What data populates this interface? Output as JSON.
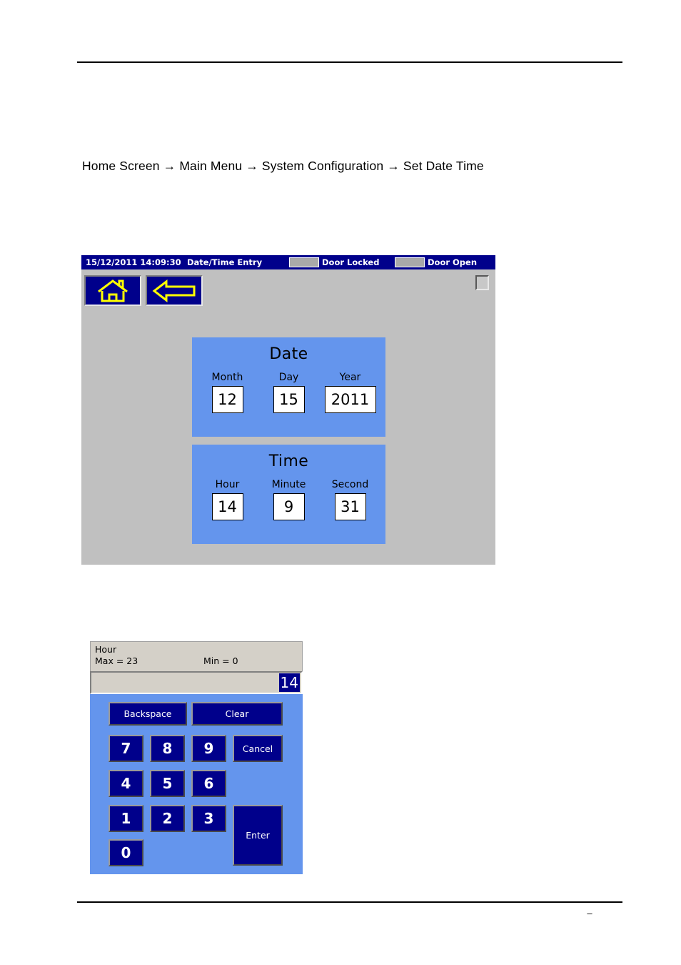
{
  "page": {
    "number": "–",
    "breadcrumb": "Home Screen → Main Menu → System Configuration → Set Date Time"
  },
  "hmi_screen": {
    "statusbar": {
      "datetime": "15/12/2011 14:09:30",
      "title": "Date/Time Entry",
      "indicators": [
        {
          "label": "Door Locked",
          "state_color": "#a9a9a9"
        },
        {
          "label": "Door Open",
          "state_color": "#a9a9a9"
        }
      ]
    },
    "nav": {
      "home_icon": "home-icon",
      "back_icon": "left-arrow-icon",
      "icon_color": "#FFFF00",
      "button_color": "#00008B"
    },
    "panels": [
      {
        "title": "Date",
        "fields": [
          {
            "label": "Month",
            "value": "12",
            "wide": false
          },
          {
            "label": "Day",
            "value": "15",
            "wide": false
          },
          {
            "label": "Year",
            "value": "2011",
            "wide": true
          }
        ]
      },
      {
        "title": "Time",
        "fields": [
          {
            "label": "Hour",
            "value": "14",
            "wide": false
          },
          {
            "label": "Minute",
            "value": "9",
            "wide": false
          },
          {
            "label": "Second",
            "value": "31",
            "wide": false
          }
        ]
      }
    ],
    "colors": {
      "background": "#c0c0c0",
      "panel": "#6495ED",
      "statusbar": "#00008B"
    }
  },
  "keypad": {
    "header": {
      "title": "Hour",
      "max_label": "Max = 23",
      "min_label": "Min = 0"
    },
    "display": {
      "value": "14",
      "selected": true
    },
    "buttons": {
      "backspace": "Backspace",
      "clear": "Clear",
      "cancel": "Cancel",
      "enter": "Enter",
      "digits": [
        "7",
        "8",
        "9",
        "4",
        "5",
        "6",
        "1",
        "2",
        "3",
        "0"
      ]
    },
    "colors": {
      "pad": "#6495ED",
      "button": "#00008B",
      "header": "#d4d0c8"
    }
  }
}
